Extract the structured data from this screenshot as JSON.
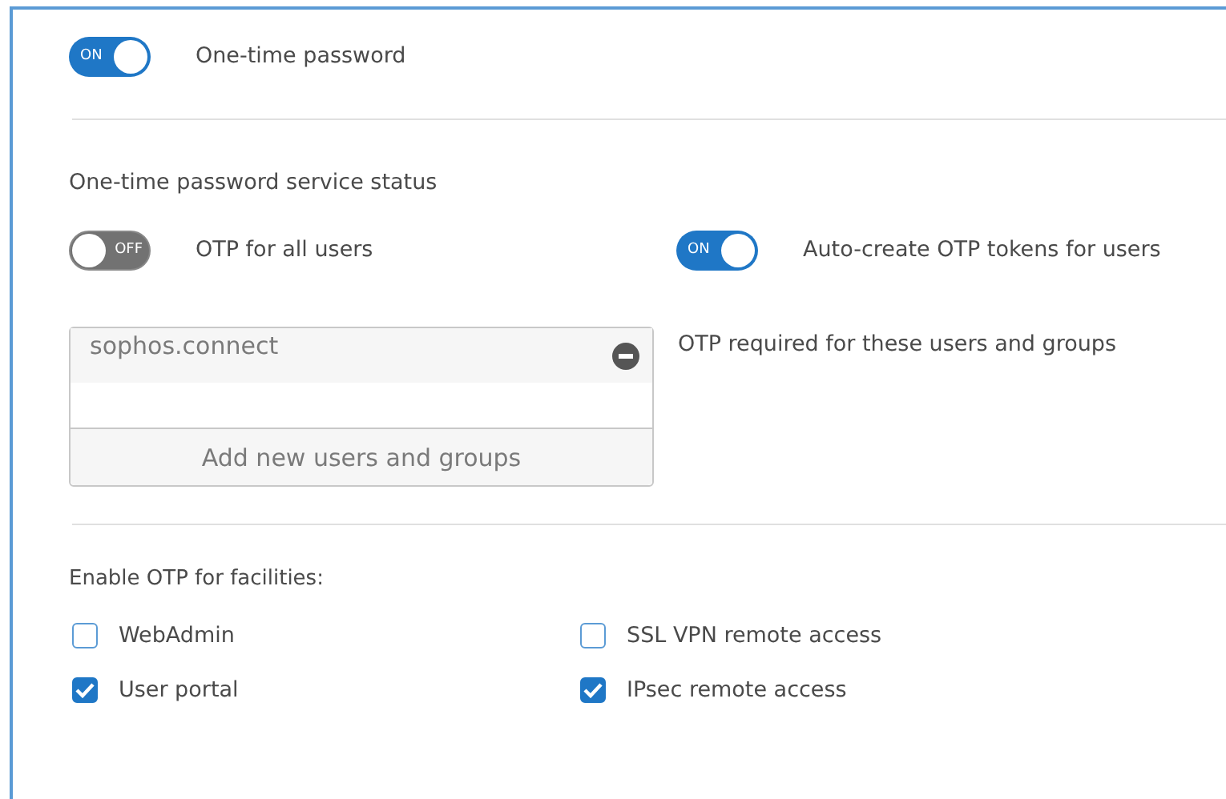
{
  "main_toggle": {
    "label": "One-time password",
    "on": true,
    "switch_text": "ON"
  },
  "service_status": {
    "heading": "One-time password service status",
    "toggles": [
      {
        "label": "OTP for all users",
        "on": false,
        "switch_text": "OFF"
      },
      {
        "label": "Auto-create OTP tokens for users",
        "on": true,
        "switch_text": "ON"
      }
    ]
  },
  "users_list": {
    "entries": [
      "sophos.connect"
    ],
    "add_button": "Add new users and groups",
    "label": "OTP required for these users and groups"
  },
  "facilities": {
    "heading": "Enable OTP for facilities:",
    "items": [
      {
        "label": "WebAdmin",
        "checked": false
      },
      {
        "label": "SSL VPN remote access",
        "checked": false
      },
      {
        "label": "User portal",
        "checked": true
      },
      {
        "label": "IPsec remote access",
        "checked": true
      }
    ]
  }
}
